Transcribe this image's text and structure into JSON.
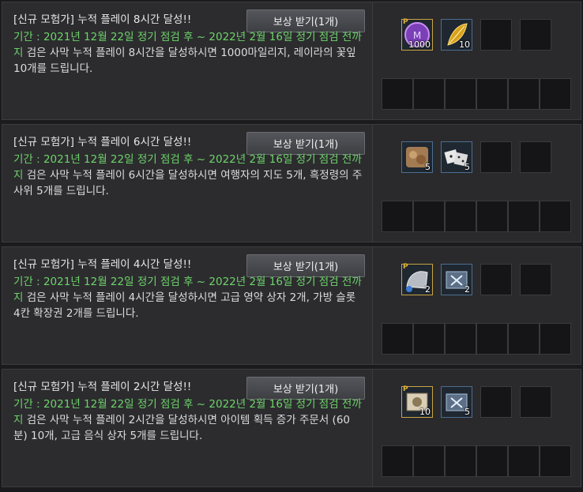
{
  "button_label": "보상 받기(1개)",
  "quests": [
    {
      "title": "[신규 모험가] 누적 플레이 8시간 달성!!",
      "period_label": "기간 : 2021년 12월 22일 정기 점검 후 ~ 2022년 2월 16일 정기 점검 전까지",
      "desc": " 검은 사막 누적 플레이 8시간을 달성하시면 1000마일리지, 레이라의 꽃잎 10개를 드립니다.",
      "rewards": [
        {
          "icon": "mileage-coin-icon",
          "qty": "1000",
          "premium": true
        },
        {
          "icon": "leila-petal-icon",
          "qty": "10",
          "premium": false
        }
      ]
    },
    {
      "title": "[신규 모험가] 누적 플레이 6시간 달성!!",
      "period_label": "기간 : 2021년 12월 22일 정기 점검 후 ~ 2022년 2월 16일 정기 점검 전까지",
      "desc": " 검은 사막 누적 플레이 6시간을 달성하시면 여행자의 지도 5개, 흑정령의 주사위 5개를 드립니다.",
      "rewards": [
        {
          "icon": "travelers-map-icon",
          "qty": "5",
          "premium": false
        },
        {
          "icon": "black-spirit-dice-icon",
          "qty": "5",
          "premium": false
        }
      ]
    },
    {
      "title": "[신규 모험가] 누적 플레이 4시간 달성!!",
      "period_label": "기간 : 2021년 12월 22일 정기 점검 후 ~ 2022년 2월 16일 정기 점검 전까지",
      "desc": " 검은 사막 누적 플레이 4시간을 달성하시면 고급 영약 상자 2개, 가방 슬롯 4칸 확장권 2개를 드립니다.",
      "rewards": [
        {
          "icon": "bag-slot-expansion-icon",
          "qty": "2",
          "premium": true
        },
        {
          "icon": "elixir-box-icon",
          "qty": "2",
          "premium": false
        }
      ]
    },
    {
      "title": "[신규 모험가] 누적 플레이 2시간 달성!!",
      "period_label": "기간 : 2021년 12월 22일 정기 점검 후 ~ 2022년 2월 16일 정기 점검 전까지",
      "desc": " 검은 사막 누적 플레이 2시간을 달성하시면 아이템 획득 증가 주문서 (60분) 10개, 고급 음식 상자 5개를 드립니다.",
      "rewards": [
        {
          "icon": "item-drop-scroll-icon",
          "qty": "10",
          "premium": true
        },
        {
          "icon": "food-box-icon",
          "qty": "5",
          "premium": false
        }
      ]
    }
  ],
  "colors": {
    "period_green": "#6ed36a",
    "background": "#1b1b1d",
    "card": "#2c2c2f"
  }
}
